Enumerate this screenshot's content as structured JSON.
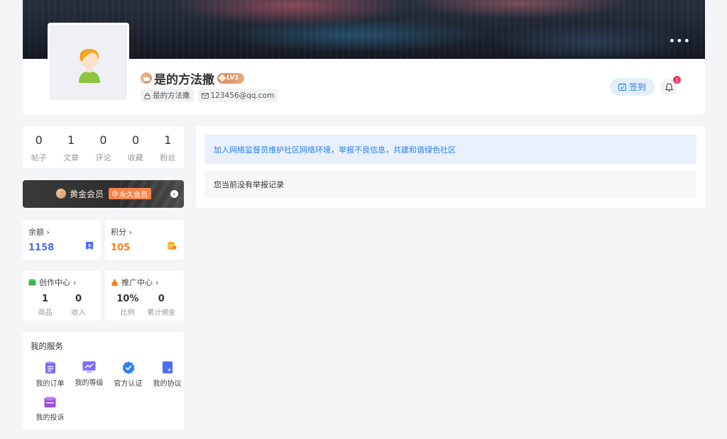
{
  "profile": {
    "user_name": "是的方法撒",
    "level": "LV1",
    "username_chip": "是的方法撒",
    "email_chip": "123456@qq.com",
    "more_menu": "•••",
    "checkin_label": "签到",
    "notification_count": "1"
  },
  "stats": [
    {
      "value": "0",
      "label": "帖子"
    },
    {
      "value": "1",
      "label": "文章"
    },
    {
      "value": "0",
      "label": "评论"
    },
    {
      "value": "0",
      "label": "收藏"
    },
    {
      "value": "1",
      "label": "粉丝"
    }
  ],
  "vip": {
    "name": "黄金会员",
    "tag": "永久会员"
  },
  "balance": {
    "title": "余额",
    "value": "1158"
  },
  "points": {
    "title": "积分",
    "value": "105"
  },
  "creation_center": {
    "title": "创作中心",
    "items": [
      {
        "value": "1",
        "label": "商品"
      },
      {
        "value": "0",
        "label": "收入"
      }
    ]
  },
  "promotion_center": {
    "title": "推广中心",
    "items": [
      {
        "value": "10%",
        "label": "比例"
      },
      {
        "value": "0",
        "label": "累计佣金"
      }
    ]
  },
  "services": {
    "title": "我的服务",
    "items": [
      {
        "label": "我的订单",
        "icon": "clipboard-icon",
        "color": "#6c63ff"
      },
      {
        "label": "我的等级",
        "icon": "chart-icon",
        "color": "#6c63ff"
      },
      {
        "label": "官方认证",
        "icon": "verified-icon",
        "color": "#2f80ed"
      },
      {
        "label": "我的协议",
        "icon": "document-star-icon",
        "color": "#4a6cf7"
      },
      {
        "label": "我的投诉",
        "icon": "inbox-icon",
        "color": "#a24be0"
      }
    ]
  },
  "main": {
    "notice": "加入网络监督员维护社区网络环境，举报不良信息，共建和谐绿色社区",
    "empty_text": "您当前没有举报记录"
  },
  "colors": {
    "accent_blue": "#2f80ed",
    "balance_blue": "#4a6cf7",
    "points_orange": "#f5821f",
    "vip_tag": "#f5854a"
  }
}
